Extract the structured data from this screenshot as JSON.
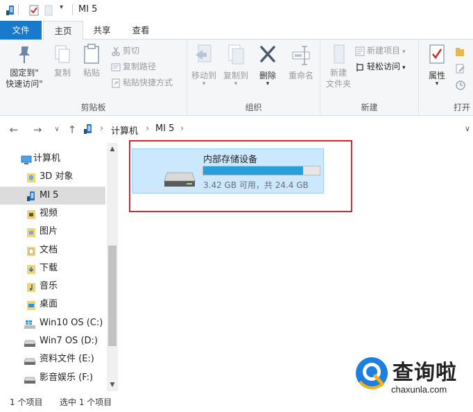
{
  "window": {
    "title": "MI 5"
  },
  "tabs": {
    "file": "文件",
    "home": "主页",
    "share": "共享",
    "view": "查看"
  },
  "ribbon": {
    "clipboard": {
      "label": "剪贴板",
      "pin_line1": "固定到\"",
      "pin_line2": "快速访问\"",
      "copy": "复制",
      "paste": "粘贴",
      "cut": "剪切",
      "copy_path": "复制路径",
      "paste_shortcut": "粘贴快捷方式"
    },
    "organize": {
      "label": "组织",
      "move_to": "移动到",
      "copy_to": "复制到",
      "delete": "删除",
      "rename": "重命名"
    },
    "new": {
      "label": "新建",
      "new_folder_line1": "新建",
      "new_folder_line2": "文件夹",
      "new_item": "新建项目",
      "easy_access": "轻松访问"
    },
    "open": {
      "label": "打开",
      "properties": "属性"
    }
  },
  "address": {
    "crumbs": [
      "计算机",
      "MI 5"
    ]
  },
  "nav": {
    "items": [
      {
        "label": "计算机",
        "icon": "computer-icon"
      },
      {
        "label": "3D 对象",
        "icon": "3d-objects-icon"
      },
      {
        "label": "MI 5",
        "icon": "phone-icon",
        "selected": true
      },
      {
        "label": "视频",
        "icon": "videos-icon"
      },
      {
        "label": "图片",
        "icon": "pictures-icon"
      },
      {
        "label": "文档",
        "icon": "documents-icon"
      },
      {
        "label": "下载",
        "icon": "downloads-icon"
      },
      {
        "label": "音乐",
        "icon": "music-icon"
      },
      {
        "label": "桌面",
        "icon": "desktop-icon"
      },
      {
        "label": "Win10 OS (C:)",
        "icon": "windows-drive-icon"
      },
      {
        "label": "Win7 OS (D:)",
        "icon": "drive-icon"
      },
      {
        "label": "资料文件 (E:)",
        "icon": "drive-icon"
      },
      {
        "label": "影音娱乐 (F:)",
        "icon": "drive-icon"
      }
    ]
  },
  "content": {
    "drive": {
      "name": "内部存储设备",
      "space": "3.42 GB 可用，共 24.4 GB",
      "used_fraction": 0.86
    }
  },
  "status": {
    "count": "1 个项目",
    "selected": "选中 1 个项目"
  },
  "watermark": {
    "cn": "查询啦",
    "en": "chaxunla.com"
  },
  "colors": {
    "accent": "#1979ca",
    "selection": "#cce8ff",
    "progress": "#26a0da",
    "highlight_box": "#c9282d"
  }
}
